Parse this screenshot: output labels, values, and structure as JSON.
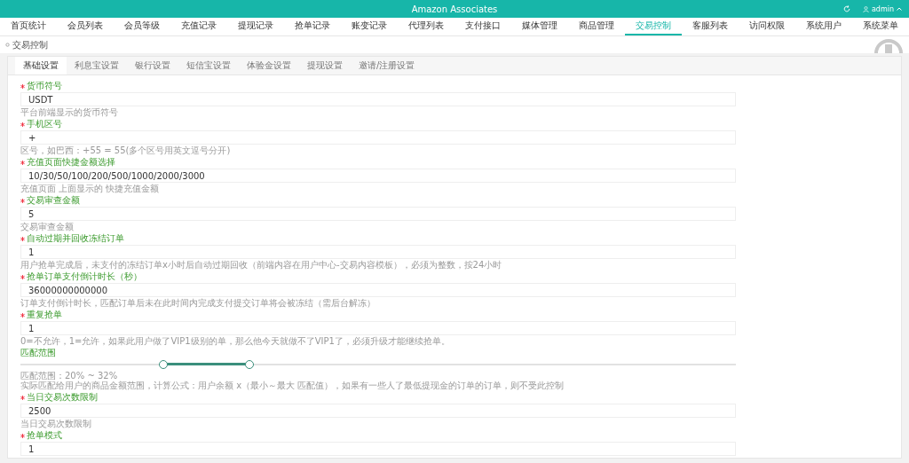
{
  "header": {
    "title": "Amazon Associates",
    "user": "admin"
  },
  "nav": [
    {
      "label": "首页统计",
      "selected": false
    },
    {
      "label": "会员列表",
      "selected": false
    },
    {
      "label": "会员等级",
      "selected": false
    },
    {
      "label": "充值记录",
      "selected": false
    },
    {
      "label": "提现记录",
      "selected": false
    },
    {
      "label": "抢单记录",
      "selected": false
    },
    {
      "label": "账变记录",
      "selected": false
    },
    {
      "label": "代理列表",
      "selected": false
    },
    {
      "label": "支付接口",
      "selected": false
    },
    {
      "label": "媒体管理",
      "selected": false
    },
    {
      "label": "商品管理",
      "selected": false
    },
    {
      "label": "交易控制",
      "selected": true
    },
    {
      "label": "客服列表",
      "selected": false
    },
    {
      "label": "访问权限",
      "selected": false
    },
    {
      "label": "系统用户",
      "selected": false
    },
    {
      "label": "系统菜单",
      "selected": false
    }
  ],
  "breadcrumb": "交易控制",
  "tabs": [
    {
      "label": "基础设置",
      "selected": true
    },
    {
      "label": "利息宝设置",
      "selected": false
    },
    {
      "label": "银行设置",
      "selected": false
    },
    {
      "label": "短信宝设置",
      "selected": false
    },
    {
      "label": "体验金设置",
      "selected": false
    },
    {
      "label": "提现设置",
      "selected": false
    },
    {
      "label": "邀请/注册设置",
      "selected": false
    }
  ],
  "fields": [
    {
      "kind": "input",
      "required": true,
      "label": "货币符号",
      "value": "USDT",
      "help": "平台前端显示的货币符号"
    },
    {
      "kind": "input",
      "required": true,
      "label": "手机区号",
      "value": "+",
      "help": "区号，如巴西：+55 = 55(多个区号用英文逗号分开)"
    },
    {
      "kind": "input",
      "required": true,
      "label": "充值页面快捷金额选择",
      "value": "10/30/50/100/200/500/1000/2000/3000",
      "help": "充值页面 上面显示的 快捷充值金额"
    },
    {
      "kind": "input",
      "required": true,
      "label": "交易审查金额",
      "value": "5",
      "help": "交易审查金额"
    },
    {
      "kind": "input",
      "required": true,
      "label": "自动过期并回收冻结订单",
      "value": "1",
      "help": "用户抢单完成后，未支付的冻结订单x小时后自动过期回收（前端内容在用户中心-交易内容模板），必须为整数，按24小时"
    },
    {
      "kind": "input",
      "required": true,
      "label": "抢单订单支付倒计时长（秒）",
      "value": "36000000000000",
      "help": "订单支付倒计时长，匹配订单后未在此时间内完成支付提交订单将会被冻结（需后台解冻）"
    },
    {
      "kind": "input",
      "required": true,
      "label": "重复抢单",
      "value": "1",
      "help": "0=不允许，1=允许，如果此用户做了VIP1级别的单，那么他今天就做不了VIP1了，必须升级才能继续抢单。"
    },
    {
      "kind": "slider",
      "required": false,
      "label": "匹配范围",
      "thumbs": [
        {
          "level": 0.2
        },
        {
          "level": 0.32
        }
      ],
      "reading": "匹配范围：20% ~ 32%",
      "help": "实际匹配给用户的商品金额范围，计算公式：用户余额 x（最小～最大 匹配值），如果有一些人了最低提现金的订单的订单，则不受此控制"
    },
    {
      "kind": "input",
      "required": true,
      "label": "当日交易次数限制",
      "value": "2500",
      "help": "当日交易次数限制"
    },
    {
      "kind": "input",
      "required": true,
      "label": "抢单模式",
      "value": "1"
    }
  ]
}
